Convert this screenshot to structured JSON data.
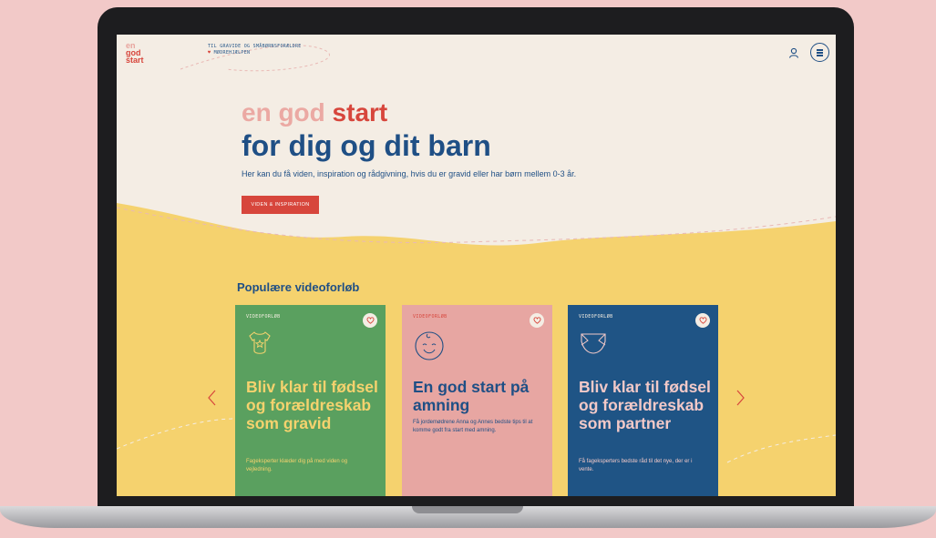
{
  "header": {
    "logo_lines": [
      "en",
      "god",
      "start"
    ],
    "tagline_line1": "TIL GRAVIDE OG SMÅBØRNSFORÆLDRE",
    "tagline_heart": "♥",
    "tagline_line2": "MØDREHJÆLPEN",
    "user_icon": "user-icon",
    "menu_icon": "hamburger-menu-icon"
  },
  "hero": {
    "line1_soft": "en god",
    "line1_strong": "start",
    "line2": "for dig og dit barn",
    "subtitle": "Her kan du få viden, inspiration og rådgivning, hvis du er gravid eller har børn mellem 0-3 år.",
    "cta": "VIDEN & INSPIRATION"
  },
  "section": {
    "title": "Populære videoforløb"
  },
  "cards": [
    {
      "kicker": "VIDEOFORLØB",
      "icon": "baby-bodysuit-icon",
      "title": "Bliv klar til fødsel og forældreskab som gravid",
      "description": "Fageksperter klæder dig på med viden og vejledning."
    },
    {
      "kicker": "VIDEOFORLØB",
      "icon": "smiling-baby-face-icon",
      "title": "En god start på amning",
      "description": "Få jordemødrene Anna og Annes bedste tips til at komme godt fra start med amning."
    },
    {
      "kicker": "VIDEOFORLØB",
      "icon": "diaper-icon",
      "title": "Bliv klar til fødsel og forældreskab som partner",
      "description": "Få fageksperters bedste råd til det nye, der er i vente."
    }
  ],
  "carousel": {
    "prev_icon": "chevron-left-icon",
    "next_icon": "chevron-right-icon"
  },
  "colors": {
    "cream": "#f4ede4",
    "yellow": "#f5d26e",
    "red": "#d7463c",
    "blue": "#1f4f85",
    "green": "#5aa05f",
    "pink": "#e7a6a2",
    "background": "#f2c9c8"
  }
}
